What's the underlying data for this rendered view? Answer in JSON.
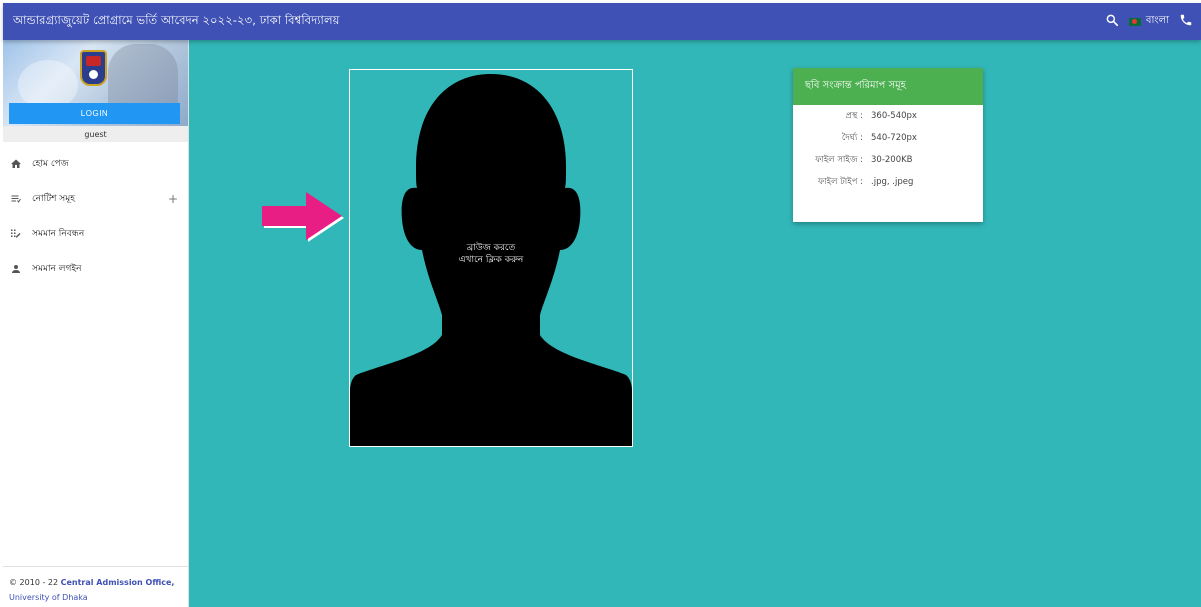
{
  "header": {
    "title": "আন্ডারগ্র্যাজুয়েট প্রোগ্রামে ভর্তি আবেদন ২০২২-২৩, ঢাকা বিশ্ববিদ্যালয়",
    "language_label": "বাংলা",
    "icons": [
      "search-icon",
      "flag-icon",
      "phone-icon"
    ]
  },
  "sidebar": {
    "login_label": "LOGIN",
    "username": "guest",
    "items": [
      {
        "label": "হোম পেজ",
        "icon": "home-icon"
      },
      {
        "label": "নোটিশ সমূহ",
        "icon": "notice-list-icon",
        "expand": "+"
      },
      {
        "label": "সমমান নিবন্ধন",
        "icon": "registration-icon"
      },
      {
        "label": "সমমান লগইন",
        "icon": "person-icon"
      }
    ],
    "footer": {
      "copyright": "© 2010 - 22 ",
      "office": "Central Admission Office,",
      "university": "University of Dhaka"
    }
  },
  "photo_upload": {
    "line1": "ব্রাউজ করতে",
    "line2": "এখানে ক্লিক করুন"
  },
  "specs": {
    "title": "ছবি সংক্রান্ত পরিমাপ সমূহ",
    "rows": [
      {
        "key": "প্রস্থ :",
        "value": "360-540px"
      },
      {
        "key": "দৈর্ঘ্য :",
        "value": "540-720px"
      },
      {
        "key": "ফাইল সাইজ :",
        "value": "30-200KB"
      },
      {
        "key": "ফাইল টাইপ :",
        "value": ".jpg, .jpeg"
      }
    ]
  },
  "colors": {
    "header": "#3f51b5",
    "content_bg": "#32b7b8",
    "card_header": "#4caf50",
    "login_button": "#2196f3",
    "arrow": "#e91e84"
  }
}
